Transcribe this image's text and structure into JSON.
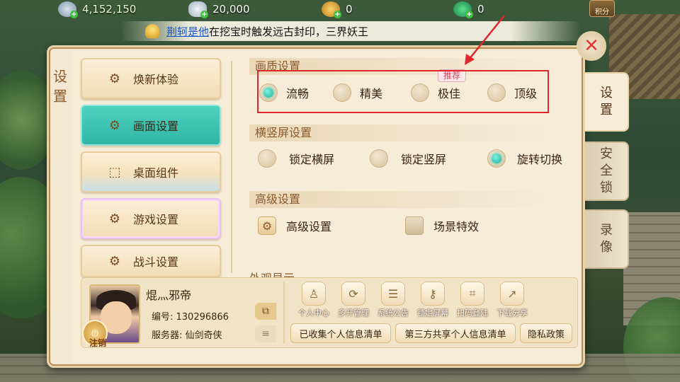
{
  "topbar": {
    "currencies": [
      {
        "icon": "silver-coin-icon",
        "value": "4,152,150"
      },
      {
        "icon": "silver-ingot-icon",
        "value": "20,000"
      },
      {
        "icon": "gold-coin-icon",
        "value": "0"
      },
      {
        "icon": "jade-icon",
        "value": "0"
      }
    ],
    "score_label": "积分"
  },
  "marquee": {
    "name": "荆轲是他",
    "text": "在挖宝时触发远古封印，三界妖王"
  },
  "panel": {
    "side_title": "设置",
    "menu": [
      {
        "label": "焕新体验",
        "icon": "phone-gear-icon"
      },
      {
        "label": "画面设置",
        "icon": "display-gear-icon",
        "active": true
      },
      {
        "label": "桌面组件",
        "icon": "widget-icon"
      },
      {
        "label": "游戏设置",
        "icon": "gears-icon"
      },
      {
        "label": "战斗设置",
        "icon": "battle-gear-icon"
      }
    ],
    "quality": {
      "header": "画质设置",
      "badge": "推荐",
      "options": [
        "流畅",
        "精美",
        "极佳",
        "顶级"
      ],
      "selected": "流畅"
    },
    "orientation": {
      "header": "横竖屏设置",
      "options": [
        "锁定横屏",
        "锁定竖屏",
        "旋转切换"
      ],
      "selected": "旋转切换"
    },
    "advanced": {
      "header": "高级设置",
      "button_label": "高级设置",
      "checkbox_label": "场景特效",
      "checkbox_checked": false
    },
    "next_section_header": "外观显示"
  },
  "profile": {
    "name": "焜灬邪帝",
    "id_line": "编号: 130296866",
    "server_line": "服务器: 仙剑奇侠",
    "logout_label": "注销",
    "tools": [
      {
        "label": "个人中心",
        "icon": "person-icon"
      },
      {
        "label": "多开管理",
        "icon": "multi-account-icon"
      },
      {
        "label": "系统公告",
        "icon": "notice-icon"
      },
      {
        "label": "锁定屏幕",
        "icon": "key-icon"
      },
      {
        "label": "扫码登陆",
        "icon": "scan-icon"
      },
      {
        "label": "下载分享",
        "icon": "share-icon"
      }
    ],
    "links": [
      "已收集个人信息清单",
      "第三方共享个人信息清单",
      "隐私政策"
    ]
  },
  "right_tabs": [
    {
      "label": "设置",
      "active": true
    },
    {
      "label": "安全锁",
      "active": false
    },
    {
      "label": "录像",
      "active": false
    }
  ],
  "colors": {
    "accent": "#2fb6a6",
    "highlight_box": "#e0262c"
  }
}
